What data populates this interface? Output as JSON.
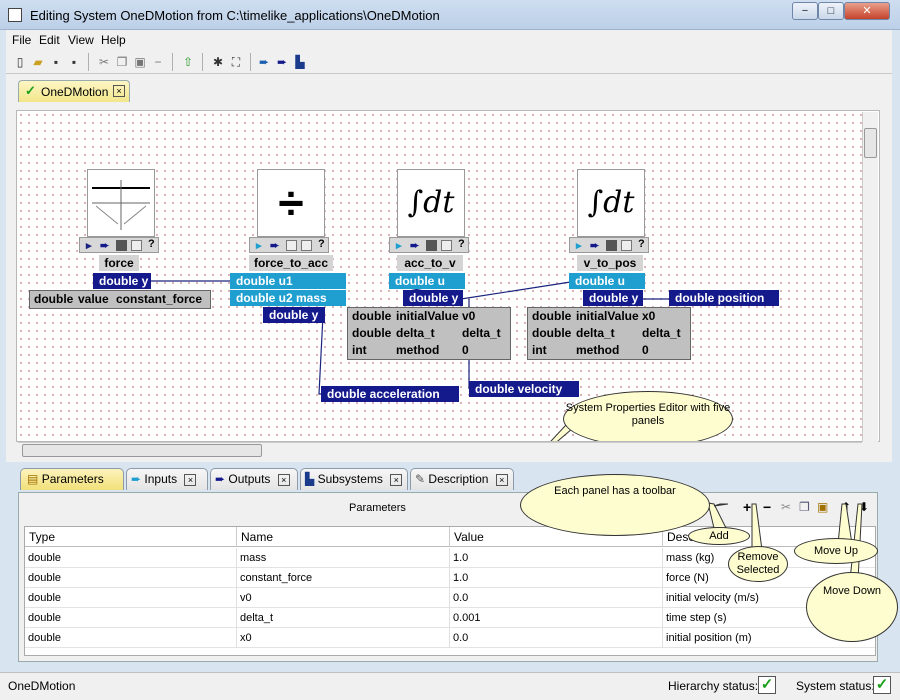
{
  "window": {
    "title": "Editing System OneDMotion from C:\\timelike_applications\\OneDMotion",
    "min": "−",
    "max": "□",
    "close": "✕"
  },
  "menu": [
    "File",
    "Edit",
    "View",
    "Help"
  ],
  "doc_tab": {
    "label": "OneDMotion",
    "close": "×"
  },
  "blocks": [
    {
      "name": "force",
      "symbol": "",
      "table": [
        [
          "double",
          "value",
          "constant_force"
        ]
      ],
      "outputs": [
        "double y"
      ],
      "inputs": []
    },
    {
      "name": "force_to_acc",
      "symbol": "÷",
      "inputs": [
        "double u1",
        "double u2 mass"
      ],
      "outputs": [
        "double y"
      ]
    },
    {
      "name": "acc_to_v",
      "symbol": "∫dt",
      "inputs": [
        "double u"
      ],
      "outputs": [
        "double y"
      ],
      "table": [
        [
          "double",
          "initialValue",
          "v0"
        ],
        [
          "double",
          "delta_t",
          "delta_t"
        ],
        [
          "int",
          "method",
          "0"
        ]
      ]
    },
    {
      "name": "v_to_pos",
      "symbol": "∫dt",
      "inputs": [
        "double u"
      ],
      "outputs": [
        "double y"
      ],
      "table": [
        [
          "double",
          "initialValue",
          "x0"
        ],
        [
          "double",
          "delta_t",
          "delta_t"
        ],
        [
          "int",
          "method",
          "0"
        ]
      ]
    }
  ],
  "system_outputs": [
    "double acceleration",
    "double velocity",
    "double position"
  ],
  "block_toolbar_help": "?",
  "callouts": {
    "editor": "System Properties Editor with five panels",
    "toolbar": "Each panel has a toolbar",
    "add": "Add",
    "remove": "Remove Selected",
    "up": "Move Up",
    "down": "Move Down"
  },
  "panel_tabs": [
    "Parameters",
    "Inputs",
    "Outputs",
    "Subsystems",
    "Description"
  ],
  "panel_tab_close": "×",
  "panel_title": "Parameters",
  "panel_toolbar": {
    "add": "+",
    "remove": "−",
    "up": "⬆",
    "down": "⬇"
  },
  "table": {
    "headers": [
      "Type",
      "Name",
      "Value",
      "Desc"
    ],
    "rows": [
      [
        "double",
        "mass",
        "1.0",
        "mass (kg)"
      ],
      [
        "double",
        "constant_force",
        "1.0",
        "force (N)"
      ],
      [
        "double",
        "v0",
        "0.0",
        "initial velocity (m/s)"
      ],
      [
        "double",
        "delta_t",
        "0.001",
        "time step (s)"
      ],
      [
        "double",
        "x0",
        "0.0",
        "initial position (m)"
      ]
    ]
  },
  "status": {
    "left": "OneDMotion",
    "hierarchy": "Hierarchy status:",
    "system": "System status:",
    "check": "✓"
  }
}
